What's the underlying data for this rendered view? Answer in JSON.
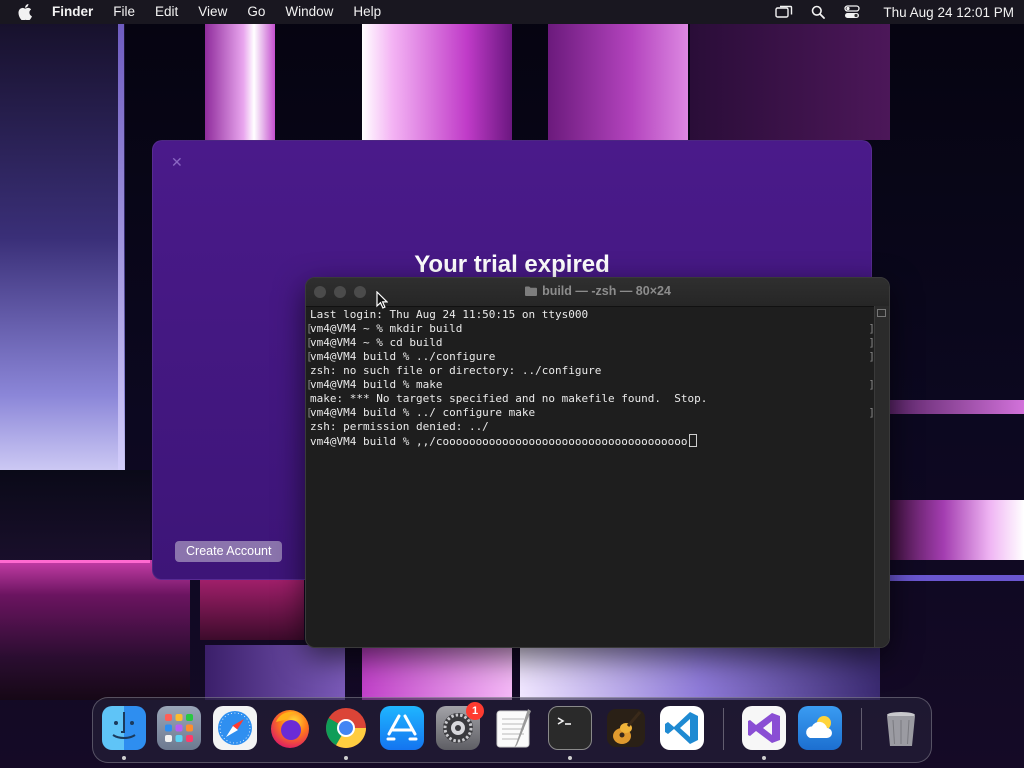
{
  "menubar": {
    "app": "Finder",
    "items": [
      "File",
      "Edit",
      "View",
      "Go",
      "Window",
      "Help"
    ],
    "clock": "Thu Aug 24  12:01 PM"
  },
  "trial_window": {
    "title": "Your trial expired",
    "button": "Create Account"
  },
  "terminal": {
    "title": "build — -zsh — 80×24",
    "lines": [
      "Last login: Thu Aug 24 11:50:15 on ttys000",
      "vm4@VM4 ~ % mkdir build",
      "vm4@VM4 ~ % cd build",
      "vm4@VM4 build % ../configure",
      "zsh: no such file or directory: ../configure",
      "vm4@VM4 build % make",
      "make: *** No targets specified and no makefile found.  Stop.",
      "vm4@VM4 build % ../ configure make",
      "zsh: permission denied: ../",
      "vm4@VM4 build % ,,/cooooooooooooooooooooooooooooooooooooo"
    ]
  },
  "dock": {
    "apps": [
      "Finder",
      "Launchpad",
      "Safari",
      "Firefox",
      "Google Chrome",
      "App Store",
      "System Settings",
      "TextEdit",
      "Terminal",
      "GarageBand",
      "Visual Studio Code",
      "Visual Studio",
      "Weather",
      "Trash"
    ],
    "settings_badge": "1"
  }
}
